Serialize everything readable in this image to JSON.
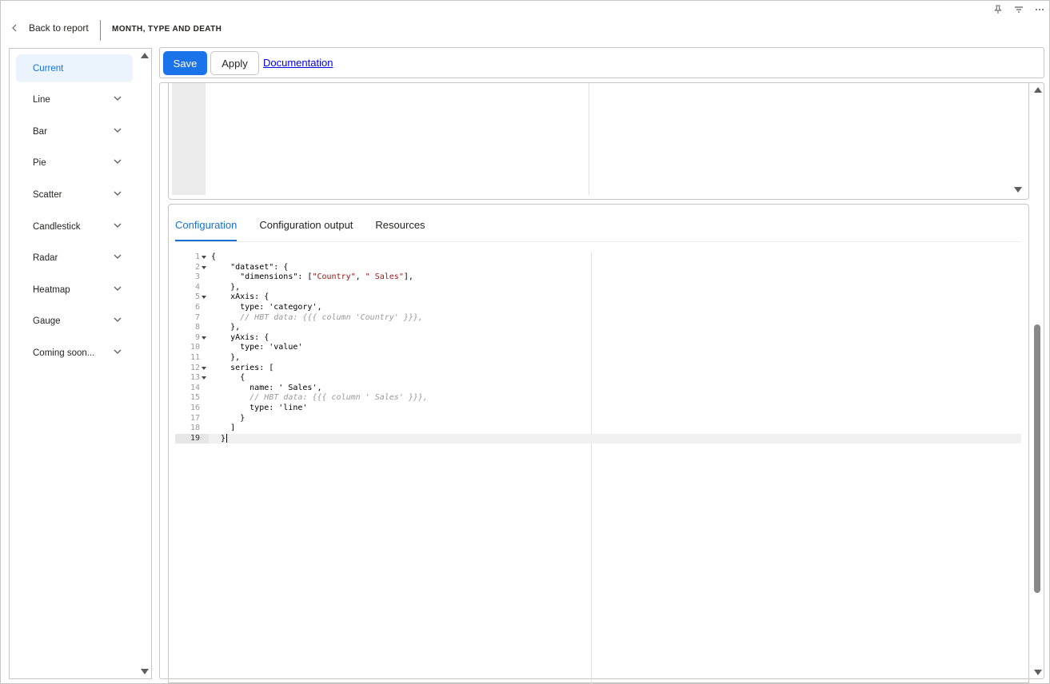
{
  "header": {
    "back_label": "Back to report",
    "title": "MONTH, TYPE AND DEATH"
  },
  "top_icons": [
    "pin-icon",
    "filter-icon",
    "more-icon"
  ],
  "sidebar": {
    "items": [
      {
        "label": "Current",
        "active": true
      },
      {
        "label": "Line"
      },
      {
        "label": "Bar"
      },
      {
        "label": "Pie"
      },
      {
        "label": "Scatter"
      },
      {
        "label": "Candlestick"
      },
      {
        "label": "Radar"
      },
      {
        "label": "Heatmap"
      },
      {
        "label": "Gauge"
      },
      {
        "label": "Coming soon..."
      }
    ]
  },
  "toolbar": {
    "save_label": "Save",
    "apply_label": "Apply",
    "doc_label": "Documentation"
  },
  "tabs": [
    {
      "label": "Configuration",
      "active": true
    },
    {
      "label": "Configuration output"
    },
    {
      "label": "Resources"
    }
  ],
  "code": {
    "current_line": 19,
    "lines": [
      {
        "n": "1",
        "fold": true,
        "html": "{"
      },
      {
        "n": "2",
        "fold": true,
        "html": "    \"dataset\": {"
      },
      {
        "n": "3",
        "fold": false,
        "html": "      \"dimensions\": [<span class='str'>\"Country\"</span>, <span class='str'>\" Sales\"</span>],"
      },
      {
        "n": "4",
        "fold": false,
        "html": "    },"
      },
      {
        "n": "5",
        "fold": true,
        "html": "    xAxis: {"
      },
      {
        "n": "6",
        "fold": false,
        "html": "      type: 'category',"
      },
      {
        "n": "7",
        "fold": false,
        "html": "      <span class='com'>// HBT data: {{{ column 'Country' }}},</span>"
      },
      {
        "n": "8",
        "fold": false,
        "html": "    },"
      },
      {
        "n": "9",
        "fold": true,
        "html": "    yAxis: {"
      },
      {
        "n": "10",
        "fold": false,
        "html": "      type: 'value'"
      },
      {
        "n": "11",
        "fold": false,
        "html": "    },"
      },
      {
        "n": "12",
        "fold": true,
        "html": "    series: ["
      },
      {
        "n": "13",
        "fold": true,
        "html": "      {"
      },
      {
        "n": "14",
        "fold": false,
        "html": "        name: ' Sales',"
      },
      {
        "n": "15",
        "fold": false,
        "html": "        <span class='com'>// HBT data: {{{ column ' Sales' }}},</span>"
      },
      {
        "n": "16",
        "fold": false,
        "html": "        type: 'line'"
      },
      {
        "n": "17",
        "fold": false,
        "html": "      }"
      },
      {
        "n": "18",
        "fold": false,
        "html": "    ]"
      },
      {
        "n": "19",
        "fold": false,
        "html": "  }"
      }
    ]
  }
}
